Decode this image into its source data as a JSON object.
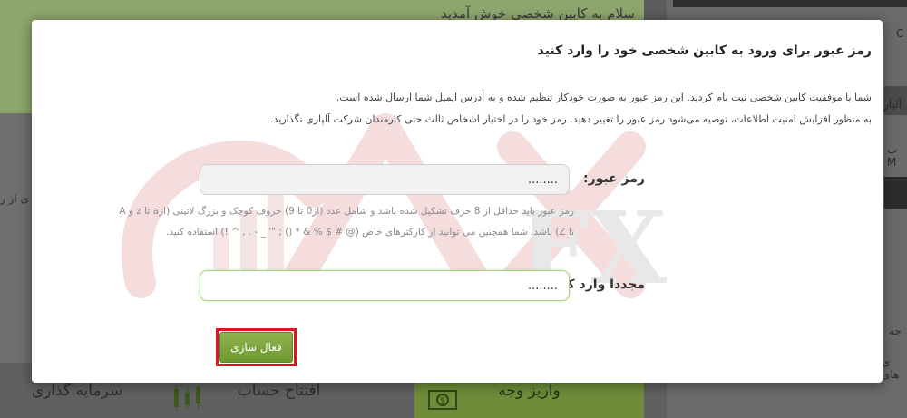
{
  "background": {
    "greeting": "سلام     به کابین شخصی خوش آمدید",
    "left_snippet": "ی از ر",
    "right_letters": [
      "C",
      "آلپار",
      "ب M",
      "جه",
      "ی های"
    ],
    "tabs": [
      {
        "label": "سرمایه گذاری",
        "icon": ""
      },
      {
        "label": "افتتاح حساب",
        "icon": "candlestick-chart-icon"
      },
      {
        "label": "واریز وجه",
        "icon": "dollar-bill-icon"
      }
    ]
  },
  "modal": {
    "title": "رمز عبور برای ورود به کابین شخصی خود را وارد کنید",
    "description": [
      "شما با موفقیت کابین شخصی ثبت نام کردید. این رمز عبور به صورت خودکار تنظیم شده و به آدرس ایمیل شما ارسال شده است.",
      "به منظور افزایش امنیت اطلاعات، توصیه می‌شود رمز عبور را تغییر دهید. رمز خود را در اختیار اشخاص ثالث حتی کارمندان شرکت آلپاری نگذارید."
    ],
    "password": {
      "label": "رمز عبور:",
      "value": "........",
      "hint": [
        "رمز عبور باید حداقل از 8 حرف تشکیل شده باشد و شامل عدد (از0 تا 9) حروف کوچک و بزرگ لاتینی (ازa تا z و A",
        "تا Z) باشد. شما همچنین می توانید از کارکترهای خاص (@ # $ % & * () ; \"' _ - . , ^ !) استفاده کنید."
      ]
    },
    "confirm": {
      "label": "مجددا وارد کنید",
      "value": "........"
    },
    "activate_label": "فعال سازی"
  },
  "colors": {
    "accent_green": "#7aa33b",
    "highlight_red": "#e3141b",
    "watermark_red": "#f3d6d6"
  }
}
